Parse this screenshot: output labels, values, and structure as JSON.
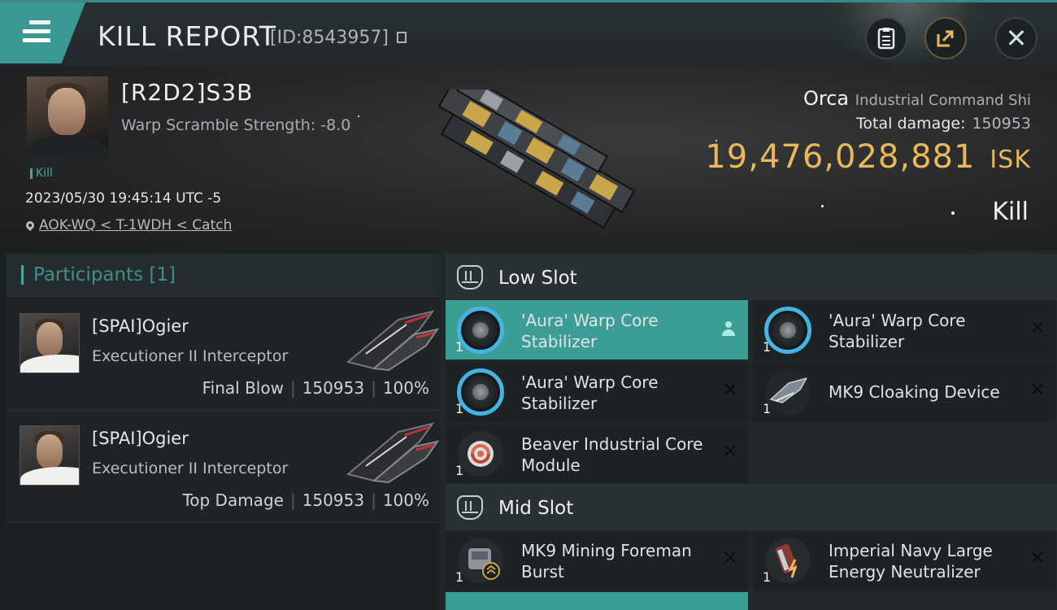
{
  "header": {
    "title": "KILL REPORT",
    "report_id": "[ID:8543957]"
  },
  "victim": {
    "name": "[R2D2]S3B",
    "warp_scramble": "Warp Scramble Strength: -8.0",
    "kill_tag": "Kill",
    "datetime": "2023/05/30 19:45:14 UTC -5",
    "location": "AOK-WQ < T-1WDH < Catch",
    "ship_name": "Orca",
    "ship_class": "Industrial Command Shi",
    "total_damage_label": "Total damage:",
    "total_damage": "150953",
    "isk_value": "19,476,028,881",
    "isk_unit": "ISK",
    "result": "Kill"
  },
  "participants": {
    "title": "Participants [1]",
    "rows": [
      {
        "name": "[SPAI]Ogier",
        "ship": "Executioner II Interceptor",
        "role": "Final Blow",
        "damage": "150953",
        "percent": "100%"
      },
      {
        "name": "[SPAI]Ogier",
        "ship": "Executioner II Interceptor",
        "role": "Top Damage",
        "damage": "150953",
        "percent": "100%"
      }
    ]
  },
  "slots": {
    "low": {
      "title": "Low Slot",
      "items": [
        {
          "name": "'Aura' Warp Core Stabilizer",
          "qty": "1",
          "icon": "warp-core-stabilizer-icon"
        },
        {
          "name": "'Aura' Warp Core Stabilizer",
          "qty": "1",
          "icon": "warp-core-stabilizer-icon"
        },
        {
          "name": "'Aura' Warp Core Stabilizer",
          "qty": "1",
          "icon": "warp-core-stabilizer-icon"
        },
        {
          "name": "MK9 Cloaking Device",
          "qty": "1",
          "icon": "cloaking-device-icon"
        },
        {
          "name": "Beaver Industrial Core Module",
          "qty": "1",
          "icon": "industrial-core-icon"
        }
      ]
    },
    "mid": {
      "title": "Mid Slot",
      "items": [
        {
          "name": "MK9 Mining Foreman Burst",
          "qty": "1",
          "icon": "mining-foreman-burst-icon"
        },
        {
          "name": "Imperial Navy Large Energy Neutralizer",
          "qty": "1",
          "icon": "energy-neutralizer-icon"
        }
      ]
    }
  },
  "colors": {
    "accent": "#3c9d95",
    "isk": "#e9b85a",
    "ring": "#46b4e2"
  }
}
